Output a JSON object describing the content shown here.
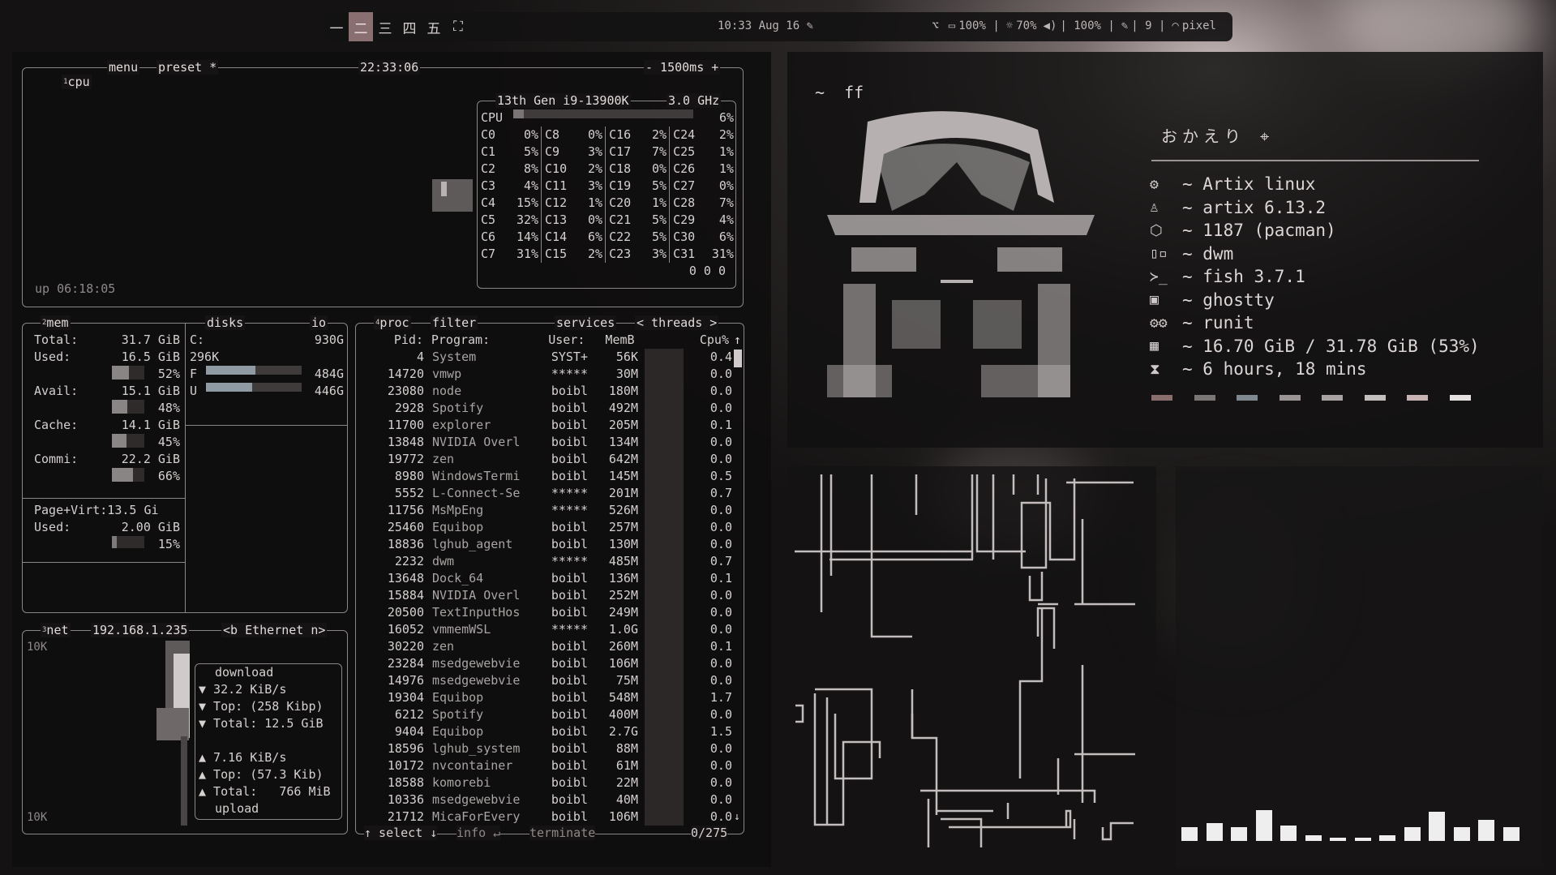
{
  "topbar": {
    "workspaces": [
      "一",
      "二",
      "三",
      "四",
      "五",
      "⛶"
    ],
    "active_index": 1,
    "clock": "10:33 Aug 16 ✎",
    "status": [
      {
        "icon": "keyboard-layout-icon",
        "glyph": "⌥",
        "text": ""
      },
      {
        "icon": "battery-icon",
        "glyph": "▭",
        "text": "100% |"
      },
      {
        "icon": "brightness-icon",
        "glyph": "☼",
        "text": "70%"
      },
      {
        "icon": "volume-icon",
        "glyph": "◀)",
        "text": "| 100% |"
      },
      {
        "icon": "notes-icon",
        "glyph": "✎",
        "text": "| 9 |"
      },
      {
        "icon": "wifi-icon",
        "glyph": "◠",
        "text": "pixel"
      }
    ]
  },
  "btop": {
    "cpu": {
      "labels": [
        "cpu",
        "menu",
        "preset *"
      ],
      "num": "1",
      "time": "22:33:06",
      "interval": "- 1500ms +",
      "model": "13th Gen i9-13900K",
      "freq": "3.0 GHz",
      "total_label": "CPU",
      "total_value": "6%",
      "total_fraction": 0.06,
      "cores": [
        [
          "C0",
          "0%",
          "C8",
          "0%",
          "C16",
          "2%",
          "C24",
          "2%"
        ],
        [
          "C1",
          "5%",
          "C9",
          "3%",
          "C17",
          "7%",
          "C25",
          "1%"
        ],
        [
          "C2",
          "8%",
          "C10",
          "2%",
          "C18",
          "0%",
          "C26",
          "1%"
        ],
        [
          "C3",
          "4%",
          "C11",
          "3%",
          "C19",
          "5%",
          "C27",
          "0%"
        ],
        [
          "C4",
          "15%",
          "C12",
          "1%",
          "C20",
          "1%",
          "C28",
          "7%"
        ],
        [
          "C5",
          "32%",
          "C13",
          "0%",
          "C21",
          "5%",
          "C29",
          "4%"
        ],
        [
          "C6",
          "14%",
          "C14",
          "6%",
          "C22",
          "5%",
          "C30",
          "6%"
        ],
        [
          "C7",
          "31%",
          "C15",
          "2%",
          "C23",
          "3%",
          "C31",
          "31%"
        ]
      ],
      "load": "0 0 0",
      "uptime": "up 06:18:05"
    },
    "mem": {
      "num": "2",
      "label": "mem",
      "total": [
        "Total:",
        "31.7 GiB"
      ],
      "items": [
        {
          "name": "Used:",
          "value": "16.5 GiB",
          "pct": "52%",
          "frac": 0.52
        },
        {
          "name": "Avail:",
          "value": "15.1 GiB",
          "pct": "48%",
          "frac": 0.48
        },
        {
          "name": "Cache:",
          "value": "14.1 GiB",
          "pct": "45%",
          "frac": 0.45
        },
        {
          "name": "Commi:",
          "value": "22.2 GiB",
          "pct": "66%",
          "frac": 0.66
        }
      ],
      "pagevirt": "Page+Virt:13.5 Gi",
      "pv_used": [
        "Used:",
        "2.00 GiB"
      ],
      "pv_pct": "15%",
      "pv_frac": 0.15
    },
    "disks": {
      "label": "disks",
      "io": "io",
      "c_label": "C:",
      "c_size": "930G",
      "c_io": "296K",
      "f": {
        "label": "F",
        "value": "484G",
        "frac": 0.52
      },
      "u": {
        "label": "U",
        "value": "446G",
        "frac": 0.48
      }
    },
    "net": {
      "num": "3",
      "label": "net",
      "ip": "192.168.1.235",
      "iface": "<b Ethernet n>",
      "scale_top": "10K",
      "scale_bottom": "10K",
      "lines": [
        "download",
        "▼ 32.2 KiB/s",
        "▼ Top: (258 Kibp)",
        "▼ Total: 12.5 GiB",
        "",
        "▲ 7.16 KiB/s",
        "▲ Top: (57.3 Kib)",
        "▲ Total:   766 MiB",
        "upload"
      ]
    },
    "proc": {
      "num": "4",
      "labels": [
        "proc",
        "filter",
        "services",
        "< threads >"
      ],
      "headers": [
        "Pid:",
        "Program:",
        "User:",
        "MemB",
        "Cpu%"
      ],
      "rows": [
        [
          "4",
          "System",
          "SYST+",
          "56K",
          "0.4"
        ],
        [
          "14720",
          "vmwp",
          "*****",
          "30M",
          "0.0"
        ],
        [
          "23080",
          "node",
          "boibl",
          "180M",
          "0.0"
        ],
        [
          "2928",
          "Spotify",
          "boibl",
          "492M",
          "0.0"
        ],
        [
          "11700",
          "explorer",
          "boibl",
          "205M",
          "0.1"
        ],
        [
          "13848",
          "NVIDIA Overl",
          "boibl",
          "134M",
          "0.0"
        ],
        [
          "19772",
          "zen",
          "boibl",
          "642M",
          "0.0"
        ],
        [
          "8980",
          "WindowsTermi",
          "boibl",
          "145M",
          "0.5"
        ],
        [
          "5552",
          "L-Connect-Se",
          "*****",
          "201M",
          "0.7"
        ],
        [
          "11756",
          "MsMpEng",
          "*****",
          "526M",
          "0.0"
        ],
        [
          "25460",
          "Equibop",
          "boibl",
          "257M",
          "0.0"
        ],
        [
          "18836",
          "lghub_agent",
          "boibl",
          "130M",
          "0.0"
        ],
        [
          "2232",
          "dwm",
          "*****",
          "485M",
          "0.7"
        ],
        [
          "13648",
          "Dock_64",
          "boibl",
          "136M",
          "0.1"
        ],
        [
          "15884",
          "NVIDIA Overl",
          "boibl",
          "252M",
          "0.0"
        ],
        [
          "20500",
          "TextInputHos",
          "boibl",
          "249M",
          "0.0"
        ],
        [
          "16052",
          "vmmemWSL",
          "*****",
          "1.0G",
          "0.0"
        ],
        [
          "30220",
          "zen",
          "boibl",
          "260M",
          "0.1"
        ],
        [
          "23284",
          "msedgewebvie",
          "boibl",
          "106M",
          "0.0"
        ],
        [
          "14976",
          "msedgewebvie",
          "boibl",
          "75M",
          "0.0"
        ],
        [
          "19304",
          "Equibop",
          "boibl",
          "548M",
          "1.7"
        ],
        [
          "6212",
          "Spotify",
          "boibl",
          "400M",
          "0.0"
        ],
        [
          "9404",
          "Equibop",
          "boibl",
          "2.7G",
          "1.5"
        ],
        [
          "18596",
          "lghub_system",
          "boibl",
          "88M",
          "0.0"
        ],
        [
          "10172",
          "nvcontainer",
          "boibl",
          "61M",
          "0.0"
        ],
        [
          "18588",
          "komorebi",
          "boibl",
          "22M",
          "0.0"
        ],
        [
          "10336",
          "msedgewebvie",
          "boibl",
          "40M",
          "0.0"
        ],
        [
          "21712",
          "MicaForEvery",
          "boibl",
          "106M",
          "0.0"
        ]
      ],
      "footer": [
        "↑ select ↓",
        "info ↵",
        "terminate",
        "0/275"
      ]
    }
  },
  "fetch": {
    "prompt": "~  ff",
    "greeting": "おかえり ⌖",
    "items": [
      {
        "icon": "gear-icon",
        "glyph": "⚙",
        "text": "~ Artix linux"
      },
      {
        "icon": "flask-icon",
        "glyph": "♙",
        "text": "~ artix 6.13.2"
      },
      {
        "icon": "package-icon",
        "glyph": "⬡",
        "text": "~ 1187 (pacman)"
      },
      {
        "icon": "window-manager-icon",
        "glyph": "▯▫",
        "text": "~ dwm"
      },
      {
        "icon": "shell-icon",
        "glyph": "≻_",
        "text": "~ fish 3.7.1"
      },
      {
        "icon": "terminal-icon",
        "glyph": "▣",
        "text": "~ ghostty"
      },
      {
        "icon": "cogs-icon",
        "glyph": "⚙⚙",
        "text": "~ runit"
      },
      {
        "icon": "memory-icon",
        "glyph": "▦",
        "text": "~ 16.70 GiB / 31.78 GiB (53%)"
      },
      {
        "icon": "hourglass-icon",
        "glyph": "⧗",
        "text": "~ 6 hours, 18 mins"
      }
    ],
    "swatches": [
      "#8a6d6d",
      "#7b7676",
      "#7f878f",
      "#9a9494",
      "#a8a2a2",
      "#c4bfbf",
      "#c7b3b3",
      "#e6e2e2"
    ]
  },
  "visualizer": {
    "levels": [
      0.35,
      0.45,
      0.35,
      0.8,
      0.4,
      0.15,
      0.08,
      0.05,
      0.15,
      0.35,
      0.75,
      0.35,
      0.55,
      0.35
    ]
  }
}
